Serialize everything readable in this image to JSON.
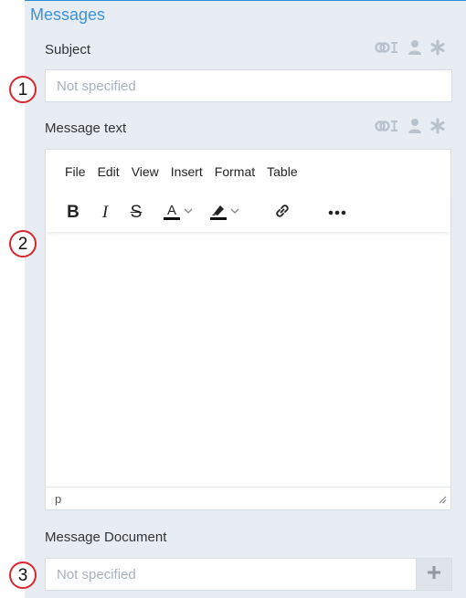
{
  "section": {
    "title": "Messages"
  },
  "subject": {
    "label": "Subject",
    "placeholder": "Not specified",
    "badge": "1",
    "icons": [
      "link-variable-icon",
      "user-icon",
      "asterisk-icon"
    ]
  },
  "message_text": {
    "label": "Message text",
    "badge": "2",
    "icons": [
      "link-variable-icon",
      "user-icon",
      "asterisk-icon"
    ],
    "menu": [
      "File",
      "Edit",
      "View",
      "Insert",
      "Format",
      "Table"
    ],
    "toolbar": [
      "bold-icon",
      "italic-icon",
      "strikethrough-icon",
      "text-color-icon",
      "chevron-down-icon",
      "highlight-color-icon",
      "chevron-down-icon",
      "link-icon",
      "more-icon"
    ],
    "status_path": "p"
  },
  "message_document": {
    "label": "Message Document",
    "placeholder": "Not specified",
    "badge": "3"
  },
  "colors": {
    "accent": "#3a8fdc",
    "panel": "#e8edf4",
    "badge_border": "#d6262e",
    "icon_muted": "#b8c2cd"
  }
}
